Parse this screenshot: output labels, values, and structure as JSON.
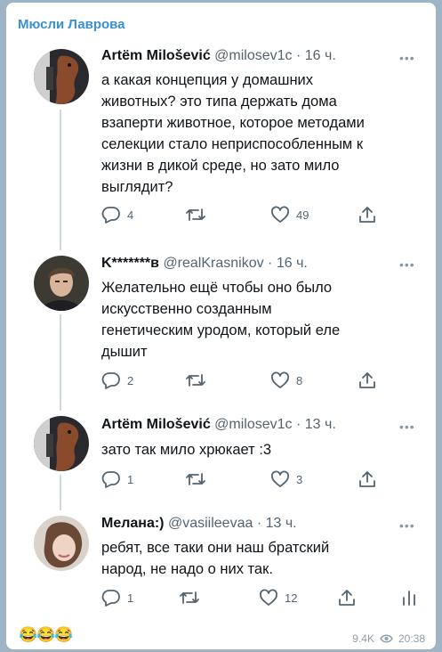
{
  "channel": {
    "name": "Мюсли Лаврова"
  },
  "tweets": [
    {
      "name": "Artëm Milošević",
      "handle": "@milosev1c",
      "time": "16 ч.",
      "lines": [
        "а какая концепция у домашних",
        "животных? это типа держать дома",
        "взаперти животное, которое методами",
        "селекции стало неприспособленным к",
        "жизни в дикой среде, но зато мило",
        "выглядит?"
      ],
      "replies": "4",
      "retweets": "",
      "likes": "49"
    },
    {
      "name": "K*******в",
      "handle": "@realKrasnikov",
      "time": "16 ч.",
      "lines": [
        "Желательно ещё чтобы оно было",
        "искусственно созданным",
        "генетическим уродом, который еле",
        "дышит"
      ],
      "replies": "2",
      "retweets": "",
      "likes": "8"
    },
    {
      "name": "Artëm Milošević",
      "handle": "@milosev1c",
      "time": "13 ч.",
      "lines": [
        "зато так мило хрюкает :3"
      ],
      "replies": "1",
      "retweets": "",
      "likes": "3"
    },
    {
      "name": "Мелана:)",
      "handle": "@vasiileevaa",
      "time": "13 ч.",
      "lines": [
        "ребят, все таки они наш братский",
        "народ, не надо о них так."
      ],
      "replies": "1",
      "retweets": "",
      "likes": "12"
    }
  ],
  "footer": {
    "reactions": "😂😂😂",
    "views": "9.4K",
    "time": "20:38"
  },
  "icons": {
    "reply": "reply-icon",
    "retweet": "retweet-icon",
    "like": "heart-icon",
    "share": "share-icon",
    "analytics": "analytics-icon",
    "more": "more-icon",
    "views": "eye-icon"
  },
  "colors": {
    "channel_name": "#3a8fd0",
    "icon_gray": "#536471",
    "background": "#9fb5c6"
  }
}
